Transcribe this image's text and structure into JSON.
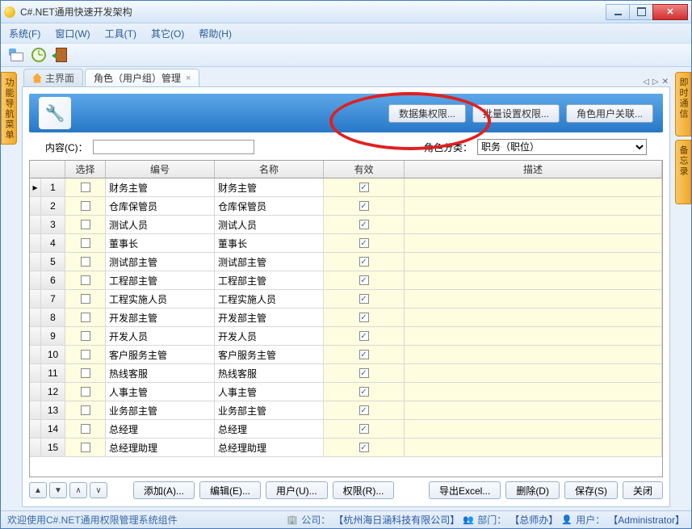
{
  "window": {
    "title": "C#.NET通用快速开发架构"
  },
  "menu": {
    "system": "系统(F)",
    "window": "窗口(W)",
    "tool": "工具(T)",
    "other": "其它(O)",
    "help": "帮助(H)"
  },
  "tabs": {
    "home": "主界面",
    "role": "角色（用户组）管理"
  },
  "header_buttons": {
    "dataset": "数据集权限...",
    "batch": "批量设置权限...",
    "userlink": "角色用户关联..."
  },
  "filter": {
    "content_label": "内容(C)：",
    "category_label": "角色分类：",
    "category_value": "职务（职位）"
  },
  "grid": {
    "headers": {
      "select": "选择",
      "code": "编号",
      "name": "名称",
      "valid": "有效",
      "desc": "描述"
    },
    "rows": [
      {
        "n": "1",
        "code": "财务主管",
        "name": "财务主管"
      },
      {
        "n": "2",
        "code": "仓库保管员",
        "name": "仓库保管员"
      },
      {
        "n": "3",
        "code": "测试人员",
        "name": "测试人员"
      },
      {
        "n": "4",
        "code": "董事长",
        "name": "董事长"
      },
      {
        "n": "5",
        "code": "测试部主管",
        "name": "测试部主管"
      },
      {
        "n": "6",
        "code": "工程部主管",
        "name": "工程部主管"
      },
      {
        "n": "7",
        "code": "工程实施人员",
        "name": "工程实施人员"
      },
      {
        "n": "8",
        "code": "开发部主管",
        "name": "开发部主管"
      },
      {
        "n": "9",
        "code": "开发人员",
        "name": "开发人员"
      },
      {
        "n": "10",
        "code": "客户服务主管",
        "name": "客户服务主管"
      },
      {
        "n": "11",
        "code": "热线客服",
        "name": "热线客服"
      },
      {
        "n": "12",
        "code": "人事主管",
        "name": "人事主管"
      },
      {
        "n": "13",
        "code": "业务部主管",
        "name": "业务部主管"
      },
      {
        "n": "14",
        "code": "总经理",
        "name": "总经理"
      },
      {
        "n": "15",
        "code": "总经理助理",
        "name": "总经理助理"
      }
    ]
  },
  "bottom": {
    "add": "添加(A)...",
    "edit": "编辑(E)...",
    "user": "用户(U)...",
    "perm": "权限(R)...",
    "export": "导出Excel...",
    "delete": "删除(D)",
    "save": "保存(S)",
    "close": "关闭"
  },
  "sidebar": {
    "left": "功能导航菜单",
    "right1": "即时通信",
    "right2": "备忘录"
  },
  "status": {
    "welcome": "欢迎使用C#.NET通用权限管理系统组件",
    "company_label": "公司：",
    "company": "【杭州海日涵科技有限公司】",
    "dept_label": "部门：",
    "dept": "【总师办】",
    "user_label": "用户：",
    "user": "【Administrator】"
  }
}
